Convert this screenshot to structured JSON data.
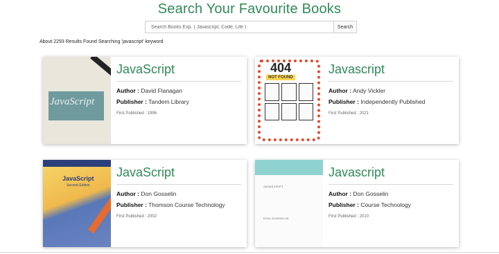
{
  "header": {
    "title": "Search Your Favourite Books"
  },
  "search": {
    "placeholder": "Search Books Exp. ( Javascript, Code, Life )",
    "value": "",
    "button_label": "Search"
  },
  "results": {
    "summary": "About 2293 Results Found Searching 'javascript' keyword"
  },
  "labels": {
    "author": "Author :",
    "publisher": "Publisher :"
  },
  "books": [
    {
      "title": "JavaScript",
      "author": "David Flanagan",
      "publisher": "Tandem Library",
      "first_published": "First Published : 1996",
      "cover_text": "JavaScript"
    },
    {
      "title": "Javascript",
      "author": "Andy Vickler",
      "publisher": "Independently Published",
      "first_published": "First Published : 2021",
      "cover_text": "404",
      "cover_sub": "NOT FOUND"
    },
    {
      "title": "JavaScript",
      "author": "Don Gosselin",
      "publisher": "Thomson Course Technology",
      "first_published": "First Published : 2002",
      "cover_text": "JavaScript",
      "cover_sub": "Second Edition"
    },
    {
      "title": "Javascript",
      "author": "Don Gosselin",
      "publisher": "Course Technology",
      "first_published": "First Published : 2010",
      "cover_text": "JAVASCRIPT",
      "cover_sub": "DON GOSSELIN"
    }
  ],
  "colors": {
    "accent": "#2e8b57",
    "card_shadow": "#d0d0d0"
  }
}
